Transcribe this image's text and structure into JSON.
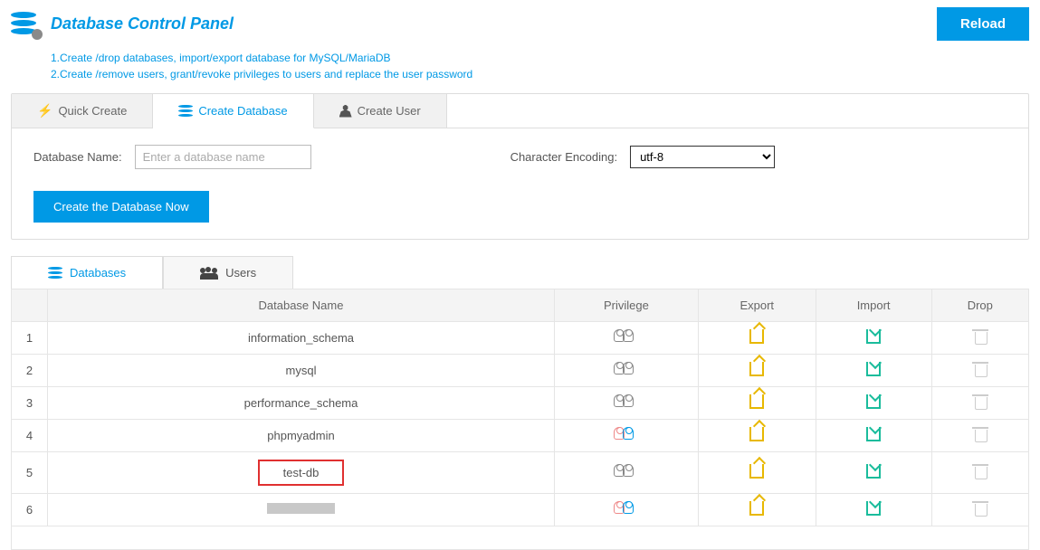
{
  "header": {
    "title": "Database Control Panel",
    "reload": "Reload"
  },
  "desc": {
    "line1": "1.Create /drop databases, import/export database for MySQL/MariaDB",
    "line2": "2.Create /remove users, grant/revoke privileges to users and replace the user password"
  },
  "topTabs": {
    "quickCreate": "Quick Create",
    "createDatabase": "Create Database",
    "createUser": "Create User"
  },
  "form": {
    "dbNameLabel": "Database Name:",
    "dbNamePlaceholder": "Enter a database name",
    "encodingLabel": "Character Encoding:",
    "encodingValue": "utf-8",
    "createBtn": "Create the Database Now"
  },
  "lowerTabs": {
    "databases": "Databases",
    "users": "Users"
  },
  "tableHeaders": {
    "name": "Database Name",
    "privilege": "Privilege",
    "export": "Export",
    "import": "Import",
    "drop": "Drop"
  },
  "rows": [
    {
      "idx": "1",
      "name": "information_schema",
      "colored": false,
      "highlight": false
    },
    {
      "idx": "2",
      "name": "mysql",
      "colored": false,
      "highlight": false
    },
    {
      "idx": "3",
      "name": "performance_schema",
      "colored": false,
      "highlight": false
    },
    {
      "idx": "4",
      "name": "phpmyadmin",
      "colored": true,
      "highlight": false
    },
    {
      "idx": "5",
      "name": "test-db",
      "colored": false,
      "highlight": true
    },
    {
      "idx": "6",
      "name": "",
      "colored": true,
      "highlight": false,
      "redacted": true
    }
  ]
}
